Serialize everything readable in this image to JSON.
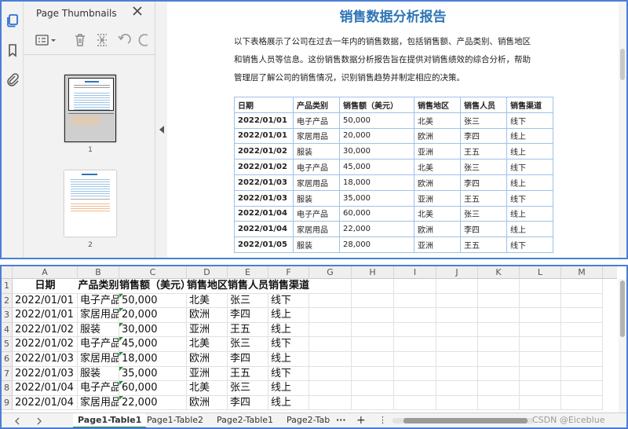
{
  "pdf_viewer": {
    "panel_title": "Page Thumbnails",
    "thumbnail_numbers": [
      "1",
      "2"
    ],
    "document": {
      "title": "销售数据分析报告",
      "paragraph_lines": [
        "以下表格展示了公司在过去一年内的销售数据，包括销售额、产品类别、销售地区",
        "和销售人员等信息。这份销售数据分析报告旨在提供对销售绩效的综合分析，帮助",
        "管理层了解公司的销售情况，识别销售趋势并制定相应的决策。"
      ],
      "table": {
        "headers": [
          "日期",
          "产品类别",
          "销售额（美元）",
          "销售地区",
          "销售人员",
          "销售渠道"
        ],
        "rows": [
          [
            "2022/01/01",
            "电子产品",
            "50,000",
            "北美",
            "张三",
            "线下"
          ],
          [
            "2022/01/01",
            "家居用品",
            "20,000",
            "欧洲",
            "李四",
            "线上"
          ],
          [
            "2022/01/02",
            "服装",
            "30,000",
            "亚洲",
            "王五",
            "线上"
          ],
          [
            "2022/01/02",
            "电子产品",
            "45,000",
            "北美",
            "张三",
            "线下"
          ],
          [
            "2022/01/03",
            "家居用品",
            "18,000",
            "欧洲",
            "李四",
            "线上"
          ],
          [
            "2022/01/03",
            "服装",
            "35,000",
            "亚洲",
            "王五",
            "线下"
          ],
          [
            "2022/01/04",
            "电子产品",
            "60,000",
            "北美",
            "张三",
            "线上"
          ],
          [
            "2022/01/04",
            "家居用品",
            "22,000",
            "欧洲",
            "李四",
            "线上"
          ],
          [
            "2022/01/05",
            "服装",
            "28,000",
            "亚洲",
            "王五",
            "线下"
          ]
        ]
      }
    }
  },
  "spreadsheet": {
    "column_letters": [
      "A",
      "B",
      "C",
      "D",
      "E",
      "F",
      "G",
      "H",
      "I",
      "J",
      "K",
      "L",
      "M"
    ],
    "row_numbers": [
      "1",
      "2",
      "3",
      "4",
      "5",
      "6",
      "7",
      "8",
      "9"
    ],
    "header_row": [
      "日期",
      "产品类别",
      "销售额（美元）",
      "销售地区",
      "销售人员",
      "销售渠道"
    ],
    "data_rows": [
      [
        "2022/01/01",
        "电子产品",
        "50,000",
        "北美",
        "张三",
        "线下"
      ],
      [
        "2022/01/01",
        "家居用品",
        "20,000",
        "欧洲",
        "李四",
        "线上"
      ],
      [
        "2022/01/02",
        "服装",
        "30,000",
        "亚洲",
        "王五",
        "线上"
      ],
      [
        "2022/01/02",
        "电子产品",
        "45,000",
        "北美",
        "张三",
        "线下"
      ],
      [
        "2022/01/03",
        "家居用品",
        "18,000",
        "欧洲",
        "李四",
        "线上"
      ],
      [
        "2022/01/03",
        "服装",
        "35,000",
        "亚洲",
        "王五",
        "线下"
      ],
      [
        "2022/01/04",
        "电子产品",
        "60,000",
        "北美",
        "张三",
        "线上"
      ],
      [
        "2022/01/04",
        "家居用品",
        "22,000",
        "欧洲",
        "李四",
        "线上"
      ]
    ],
    "tabs": [
      "Page1-Table1",
      "Page1-Table2",
      "Page2-Table1",
      "Page2-Tab"
    ],
    "active_tab": "Page1-Table1",
    "tab_more": "···",
    "tab_add": "+",
    "tab_menu": "⋮",
    "watermark": "CSDN @Eiceblue"
  },
  "icons": {
    "rail": [
      "copy-pages-icon",
      "bookmark-icon",
      "attachment-icon"
    ],
    "toolbar": [
      "list-options-icon",
      "trash-icon",
      "cut-pages-icon",
      "undo-icon",
      "redo-icon"
    ],
    "accent": "#2e75b6",
    "table_border": "#9dc3e6",
    "active_tab_underline": "#1e8a3c"
  }
}
